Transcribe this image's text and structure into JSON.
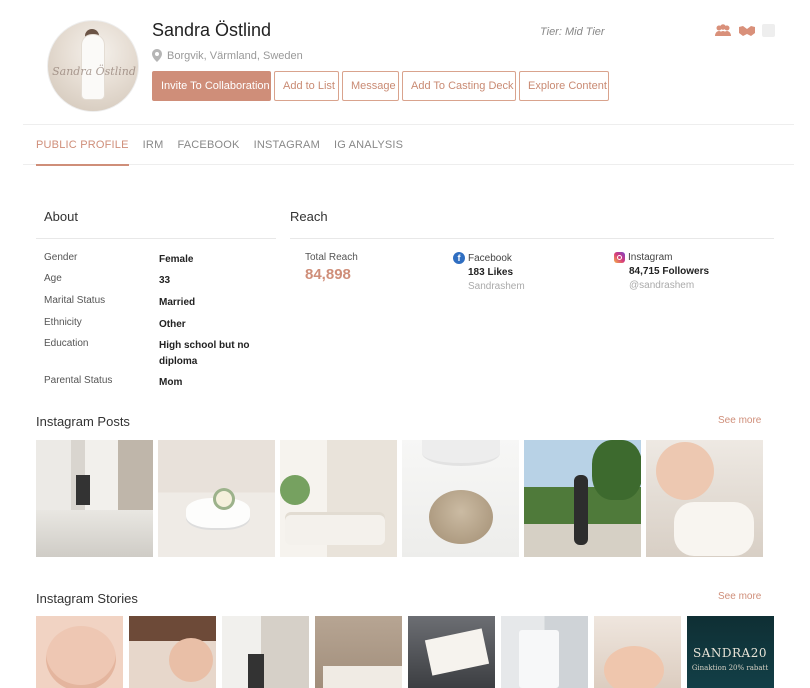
{
  "profile": {
    "name": "Sandra Östlind",
    "location": "Borgvik, Värmland, Sweden",
    "tier": "Tier: Mid Tier",
    "avatar_watermark": "Sandra Östlind"
  },
  "actions": {
    "invite": "Invite To Collaboration",
    "add_list": "Add to List",
    "message": "Message",
    "casting": "Add To Casting Deck",
    "explore": "Explore Content"
  },
  "tabs": [
    "PUBLIC PROFILE",
    "IRM",
    "FACEBOOK",
    "INSTAGRAM",
    "IG ANALYSIS"
  ],
  "about": {
    "title": "About",
    "rows": [
      {
        "label": "Gender",
        "value": "Female"
      },
      {
        "label": "Age",
        "value": "33"
      },
      {
        "label": "Marital Status",
        "value": "Married"
      },
      {
        "label": "Ethnicity",
        "value": "Other"
      },
      {
        "label": "Education",
        "value": "High school but no diploma"
      },
      {
        "label": "Parental Status",
        "value": "Mom"
      }
    ]
  },
  "reach": {
    "title": "Reach",
    "total_label": "Total Reach",
    "total_value": "84,898",
    "facebook": {
      "name": "Facebook",
      "count": "183 Likes",
      "handle": "Sandrashem"
    },
    "instagram": {
      "name": "Instagram",
      "count": "84,715 Followers",
      "handle": "@sandrashem"
    }
  },
  "posts": {
    "title": "Instagram Posts",
    "see_more": "See more"
  },
  "stories": {
    "title": "Instagram Stories",
    "see_more": "See more",
    "promo_code": "SANDRA20",
    "promo_sub": "Ginaktion 20% rabatt"
  },
  "colors": {
    "accent": "#cf8e79",
    "facebook": "#2f6ec1"
  }
}
